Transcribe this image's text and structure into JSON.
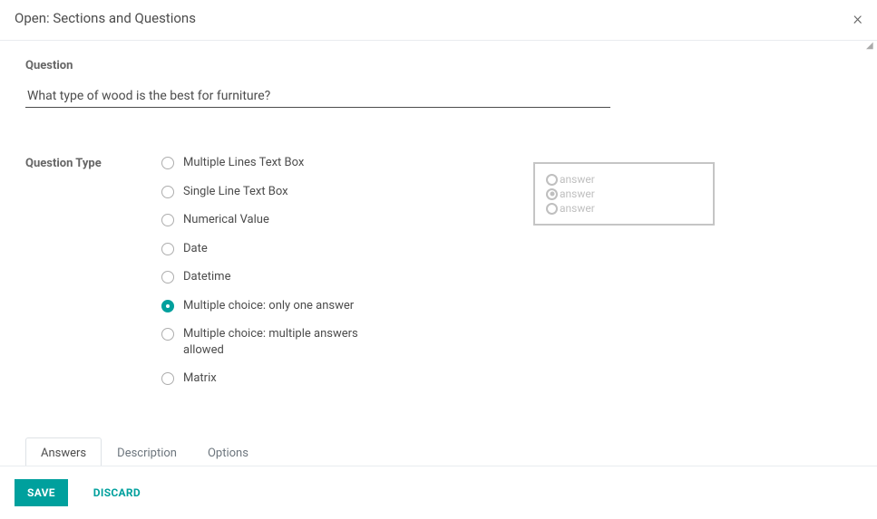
{
  "header": {
    "title": "Open: Sections and Questions"
  },
  "question": {
    "label": "Question",
    "value": "What type of wood is the best for furniture?"
  },
  "question_type": {
    "label": "Question Type",
    "options": [
      {
        "label": "Multiple Lines Text Box",
        "selected": false
      },
      {
        "label": "Single Line Text Box",
        "selected": false
      },
      {
        "label": "Numerical Value",
        "selected": false
      },
      {
        "label": "Date",
        "selected": false
      },
      {
        "label": "Datetime",
        "selected": false
      },
      {
        "label": "Multiple choice: only one answer",
        "selected": true
      },
      {
        "label": "Multiple choice: multiple answers allowed",
        "selected": false
      },
      {
        "label": "Matrix",
        "selected": false
      }
    ]
  },
  "preview": {
    "rows": [
      {
        "label": "answer",
        "filled": false
      },
      {
        "label": "answer",
        "filled": true
      },
      {
        "label": "answer",
        "filled": false
      }
    ]
  },
  "tabs": {
    "items": [
      {
        "label": "Answers",
        "active": true
      },
      {
        "label": "Description",
        "active": false
      },
      {
        "label": "Options",
        "active": false
      }
    ]
  },
  "footer": {
    "save": "SAVE",
    "discard": "DISCARD"
  }
}
